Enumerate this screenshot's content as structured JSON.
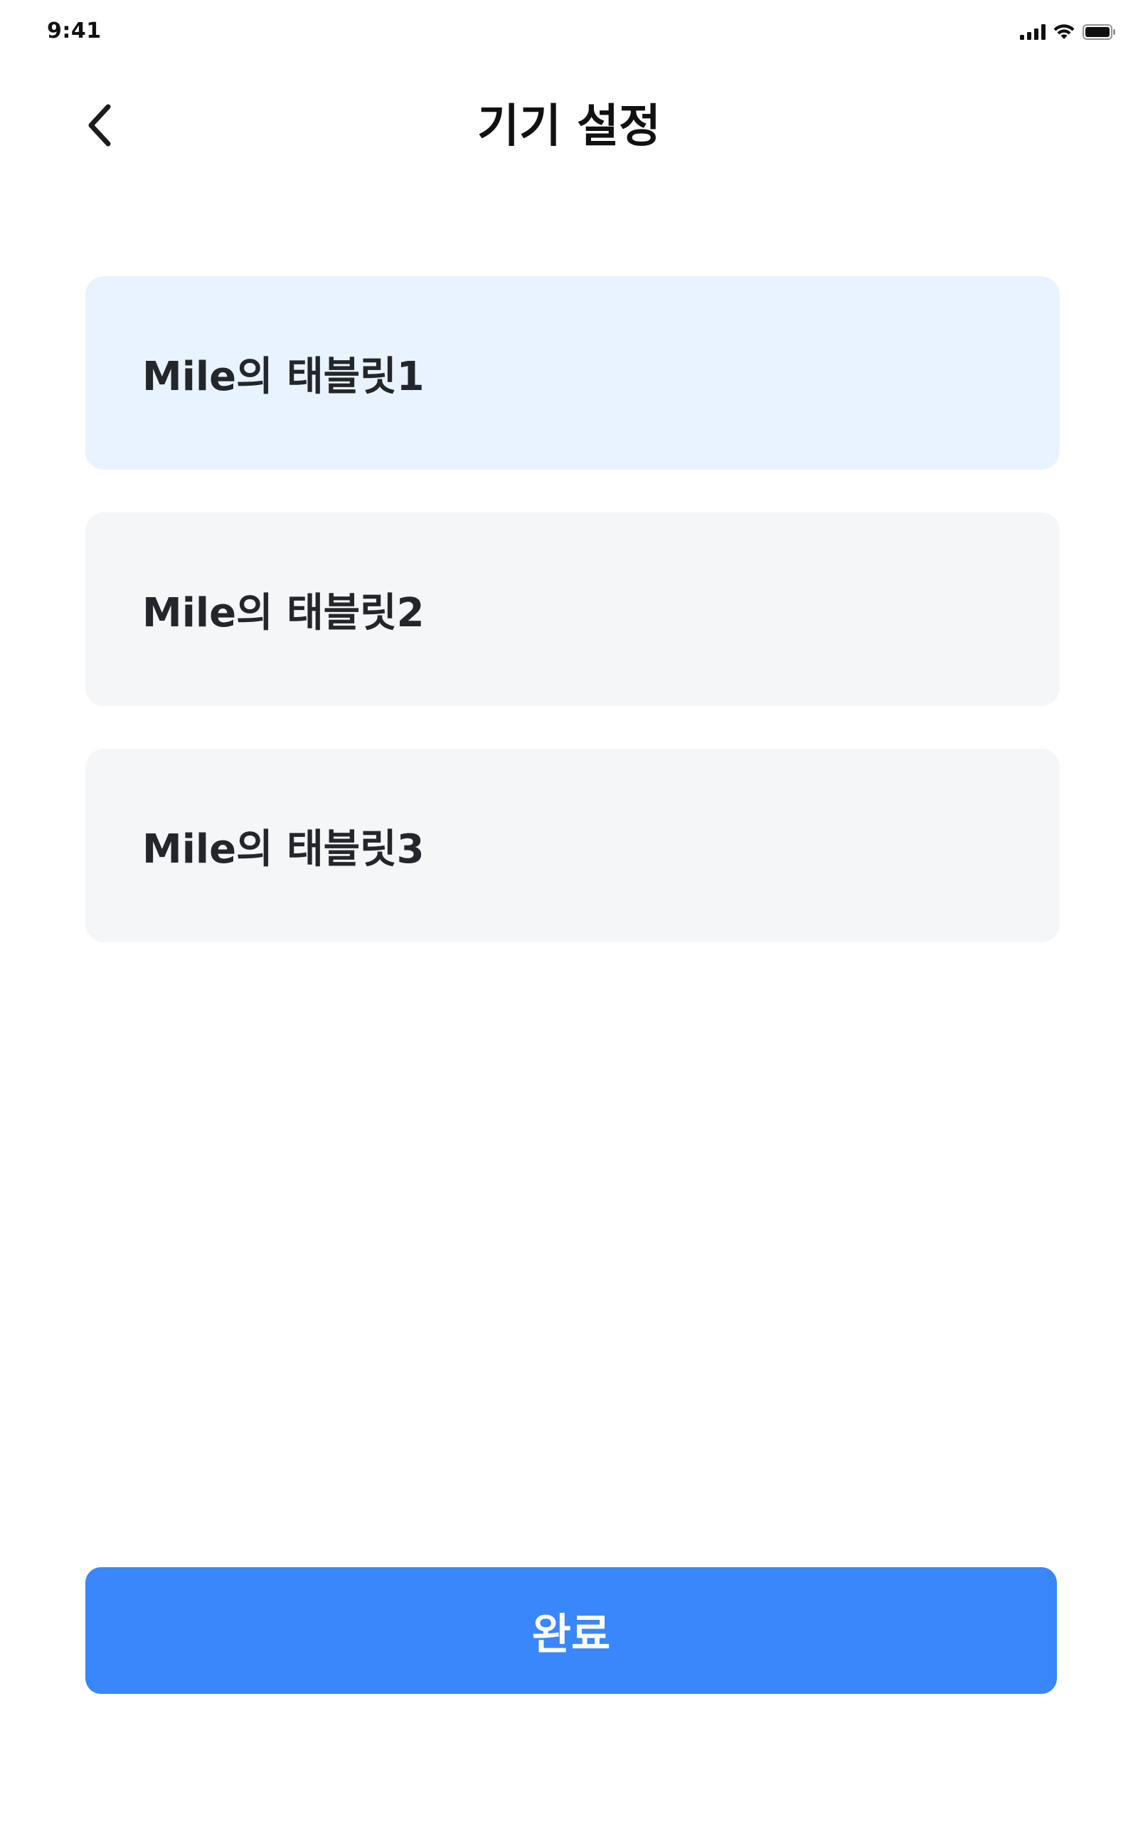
{
  "status_bar": {
    "time": "9:41",
    "icons": [
      "cellular-signal-icon",
      "wifi-icon",
      "battery-icon"
    ]
  },
  "header": {
    "title": "기기 설정",
    "back_icon": "chevron-left-icon"
  },
  "devices": [
    {
      "label": "Mile의 태블릿1",
      "selected": true
    },
    {
      "label": "Mile의 태블릿2",
      "selected": false
    },
    {
      "label": "Mile의 태블릿3",
      "selected": false
    }
  ],
  "footer": {
    "done_label": "완료"
  },
  "colors": {
    "accent": "#3a86fb",
    "selected_bg": "#e9f3ff",
    "item_bg": "#f5f6f8",
    "text": "#23262b"
  }
}
